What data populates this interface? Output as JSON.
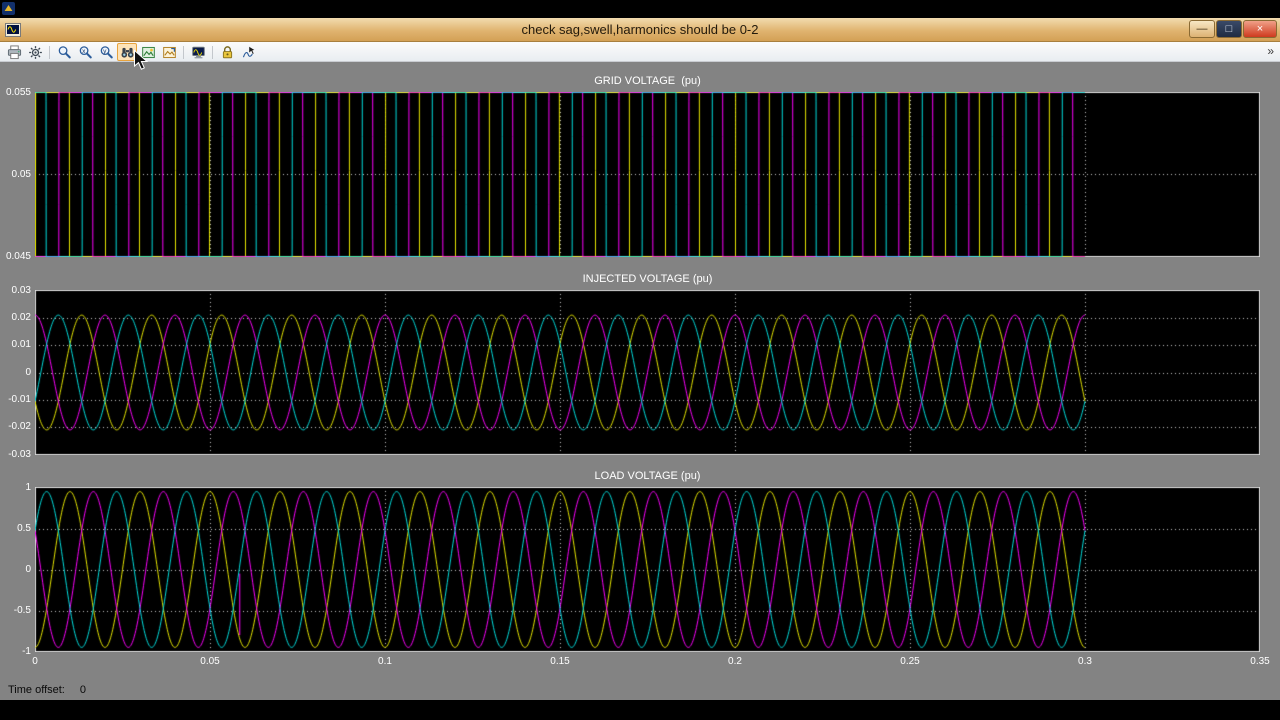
{
  "window": {
    "title": "check sag,swell,harmonics should be 0-2",
    "controls": {
      "minimize": "—",
      "maximize": "□",
      "close": "×"
    }
  },
  "toolbar": {
    "buttons": [
      {
        "id": "print",
        "label": "Print",
        "highlighted": false
      },
      {
        "id": "parameters",
        "label": "Parameters",
        "highlighted": false
      },
      {
        "id": "zoom",
        "label": "Zoom",
        "highlighted": false
      },
      {
        "id": "zoom-x",
        "label": "Zoom X-axis",
        "highlighted": false
      },
      {
        "id": "zoom-y",
        "label": "Zoom Y-axis",
        "highlighted": false
      },
      {
        "id": "autoscale",
        "label": "Autoscale",
        "highlighted": true
      },
      {
        "id": "save-axes",
        "label": "Save current axes settings",
        "highlighted": false
      },
      {
        "id": "restore-axes",
        "label": "Restore saved axes settings",
        "highlighted": false
      },
      {
        "id": "floating-scope",
        "label": "Floating scope",
        "highlighted": false
      },
      {
        "id": "lock-axes",
        "label": "Lock/Unlock Axes selection",
        "highlighted": false
      },
      {
        "id": "signal-selection",
        "label": "Signal selection",
        "highlighted": false
      }
    ],
    "overflow_chevron": "»"
  },
  "status": {
    "time_offset_label": "Time offset:",
    "time_offset_value": "0"
  },
  "chart_data": [
    {
      "type": "line",
      "title": "GRID VOLTAGE  (pu)",
      "xlim": [
        0,
        0.35
      ],
      "ylim": [
        0.045,
        0.055
      ],
      "t_end": 0.3,
      "grid": "dotted",
      "x_gridlines": [
        0.05,
        0.1,
        0.15,
        0.2,
        0.25,
        0.3
      ],
      "y_gridlines": [
        0.05
      ],
      "yticks": [
        {
          "v": 0.055,
          "label": "0.055"
        },
        {
          "v": 0.05,
          "label": "0.05"
        },
        {
          "v": 0.045,
          "label": "0.045"
        }
      ],
      "signal": {
        "kind": "three_phase_sine",
        "frequency_hz": 50,
        "amplitude": 1.0,
        "offset": 0,
        "clamp_to_ylim": true,
        "sample_dt": 2e-05
      },
      "series": [
        {
          "name": "phase-a",
          "color": "#e8e800",
          "phase_deg": 0
        },
        {
          "name": "phase-b",
          "color": "#ff00ff",
          "phase_deg": -120
        },
        {
          "name": "phase-c",
          "color": "#00e0e0",
          "phase_deg": 120
        }
      ]
    },
    {
      "type": "line",
      "title": "INJECTED VOLTAGE (pu)",
      "xlim": [
        0,
        0.35
      ],
      "ylim": [
        -0.03,
        0.03
      ],
      "t_end": 0.3,
      "grid": "dotted",
      "x_gridlines": [
        0.05,
        0.1,
        0.15,
        0.2,
        0.25,
        0.3
      ],
      "y_gridlines": [
        -0.02,
        -0.01,
        0,
        0.01,
        0.02
      ],
      "yticks": [
        {
          "v": 0.03,
          "label": "0.03"
        },
        {
          "v": 0.02,
          "label": "0.02"
        },
        {
          "v": 0.01,
          "label": "0.01"
        },
        {
          "v": 0,
          "label": "0"
        },
        {
          "v": -0.01,
          "label": "-0.01"
        },
        {
          "v": -0.02,
          "label": "-0.02"
        },
        {
          "v": -0.03,
          "label": "-0.03"
        }
      ],
      "signal": {
        "kind": "three_phase_sine",
        "frequency_hz": 50,
        "amplitude": 0.021,
        "offset": 0,
        "clamp_to_ylim": false,
        "sample_dt": 0.0002
      },
      "series": [
        {
          "name": "phase-a",
          "color": "#e8e800",
          "phase_deg": 210
        },
        {
          "name": "phase-b",
          "color": "#ff00ff",
          "phase_deg": 90
        },
        {
          "name": "phase-c",
          "color": "#00e0e0",
          "phase_deg": -30
        }
      ]
    },
    {
      "type": "line",
      "title": "LOAD VOLTAGE (pu)",
      "xlim": [
        0,
        0.35
      ],
      "ylim": [
        -1,
        1
      ],
      "t_end": 0.3,
      "grid": "dotted",
      "x_gridlines": [
        0.05,
        0.1,
        0.15,
        0.2,
        0.25,
        0.3
      ],
      "y_gridlines": [
        -0.5,
        0,
        0.5
      ],
      "yticks": [
        {
          "v": 1,
          "label": "1"
        },
        {
          "v": 0.5,
          "label": "0.5"
        },
        {
          "v": 0,
          "label": "0"
        },
        {
          "v": -0.5,
          "label": "-0.5"
        },
        {
          "v": -1,
          "label": "-1"
        }
      ],
      "xticks": [
        {
          "v": 0,
          "label": "0"
        },
        {
          "v": 0.05,
          "label": "0.05"
        },
        {
          "v": 0.1,
          "label": "0.1"
        },
        {
          "v": 0.15,
          "label": "0.15"
        },
        {
          "v": 0.2,
          "label": "0.2"
        },
        {
          "v": 0.25,
          "label": "0.25"
        },
        {
          "v": 0.3,
          "label": "0.3"
        },
        {
          "v": 0.35,
          "label": "0.35"
        }
      ],
      "signal": {
        "kind": "three_phase_sine",
        "frequency_hz": 50,
        "amplitude": 0.95,
        "offset": 0,
        "clamp_to_ylim": false,
        "sample_dt": 0.0002
      },
      "series": [
        {
          "name": "phase-a",
          "color": "#e8e800",
          "phase_deg": -90
        },
        {
          "name": "phase-b",
          "color": "#ff00ff",
          "phase_deg": 150
        },
        {
          "name": "phase-c",
          "color": "#00e0e0",
          "phase_deg": 30
        }
      ],
      "spikes": [
        {
          "t": 0.0585,
          "from": -0.05,
          "to": -0.8,
          "color": "#ff00ff"
        }
      ]
    }
  ]
}
